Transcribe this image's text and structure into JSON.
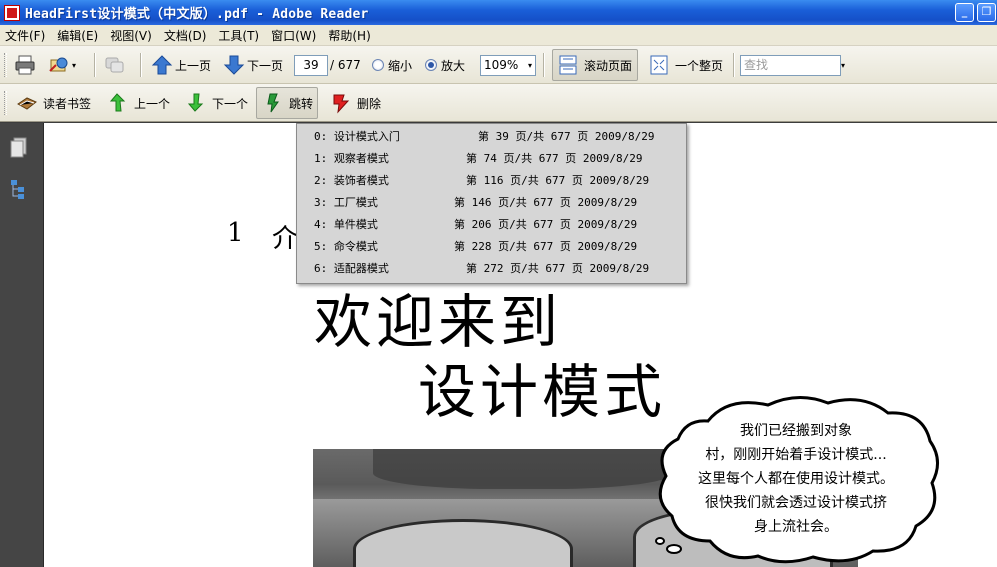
{
  "window": {
    "title": "HeadFirst设计模式（中文版）.pdf - Adobe Reader",
    "minimize_glyph": "_",
    "restore_glyph": "❐"
  },
  "menu": [
    "文件(F)",
    "编辑(E)",
    "视图(V)",
    "文档(D)",
    "工具(T)",
    "窗口(W)",
    "帮助(H)"
  ],
  "toolbar1": {
    "prev_page_label": "上一页",
    "next_page_label": "下一页",
    "current_page": "39",
    "total_pages": "/ 677",
    "zoom_out_label": "缩小",
    "zoom_in_label": "放大",
    "zoom_value": "109%",
    "scroll_page_label": "滚动页面",
    "single_page_label": "一个整页",
    "find_placeholder": "查找"
  },
  "toolbar2": {
    "reader_bookmark_label": "读者书签",
    "previous_label": "上一个",
    "next_label": "下一个",
    "jump_label": "跳转",
    "delete_label": "删除"
  },
  "bookmarks": [
    {
      "name": "0: 设计模式入门",
      "info": "第 39 页/共 677 页 2009/8/29"
    },
    {
      "name": "1: 观察者模式",
      "info": "第 74 页/共 677 页 2009/8/29"
    },
    {
      "name": "2: 装饰者模式",
      "info": "第 116 页/共 677 页 2009/8/29"
    },
    {
      "name": "3: 工厂模式",
      "info": "第 146 页/共 677 页 2009/8/29"
    },
    {
      "name": "4: 单件模式",
      "info": "第 206 页/共 677 页 2009/8/29"
    },
    {
      "name": "5: 命令模式",
      "info": "第 228 页/共 677 页 2009/8/29"
    },
    {
      "name": "6: 适配器模式",
      "info": "第 272 页/共 677 页 2009/8/29"
    }
  ],
  "document": {
    "chapter_number": "1",
    "chapter_title_visible": "介",
    "heading_line1": "欢迎来到",
    "heading_line2": "设计模式",
    "bubble_lines": [
      "我们已经搬到对象",
      "村，刚刚开始着手设计模式...",
      "这里每个人都在使用设计模式。",
      "很快我们就会透过设计模式挤",
      "身上流社会。"
    ]
  },
  "icons": {
    "print": "printer-icon",
    "email": "email-icon",
    "prev": "arrow-up-icon",
    "next": "arrow-down-icon",
    "dropdown": "▾"
  }
}
